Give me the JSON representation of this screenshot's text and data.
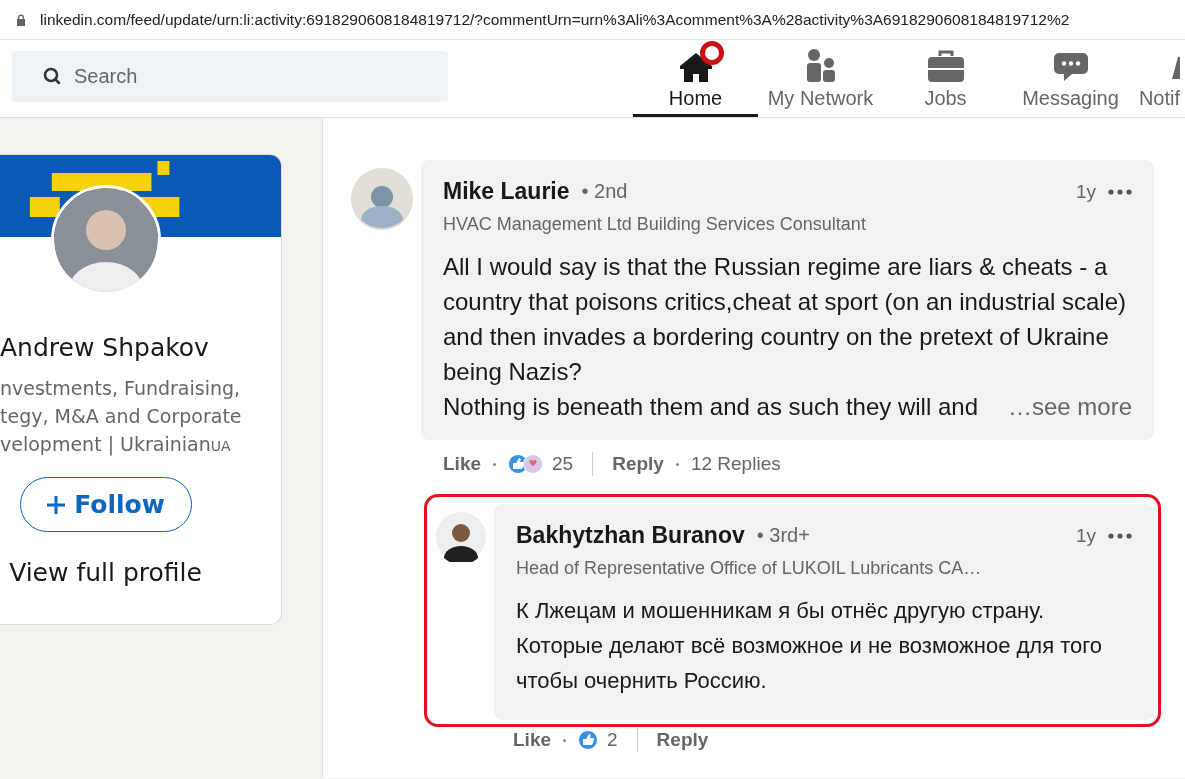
{
  "address_bar": {
    "url": "linkedin.com/feed/update/urn:li:activity:6918290608184819712/?commentUrn=urn%3Ali%3Acomment%3A%28activity%3A6918290608184819712%2"
  },
  "nav": {
    "search": {
      "placeholder": "Search"
    },
    "items": [
      {
        "label": "Home",
        "selected": true,
        "notification_dot": true
      },
      {
        "label": "My Network",
        "selected": false,
        "notification_dot": false
      },
      {
        "label": "Jobs",
        "selected": false,
        "notification_dot": false
      },
      {
        "label": "Messaging",
        "selected": false,
        "notification_dot": false
      },
      {
        "label": "Notif",
        "selected": false,
        "notification_dot": false
      }
    ]
  },
  "profile_card": {
    "name": "Andrew Shpakov",
    "headline_lines": [
      "nvestments, Fundraising,",
      "tegy, M&A and Corporate",
      "velopment | Ukrainian"
    ],
    "headline_tag": "UA",
    "follow_button": "Follow",
    "view_profile": "View full profile"
  },
  "comments": [
    {
      "author": "Mike Laurie",
      "degree": "• 2nd",
      "headline": "HVAC Management Ltd Building Services Consultant",
      "time": "1y",
      "body": [
        "All I would say is that the Russian regime are liars & cheats - a country that poisons critics,cheat at sport (on an industrial scale) and then invades a bordering country on the pretext of Ukraine being Nazis?",
        "Nothing is beneath them and as such they will and"
      ],
      "see_more": "…see more",
      "actions": {
        "like": "Like",
        "reaction_count": "25",
        "reply": "Reply",
        "replies": "12 Replies"
      },
      "replies": [
        {
          "author": "Bakhytzhan Buranov",
          "degree": "• 3rd+",
          "headline": "Head of Representative Office of LUKOIL Lubricants CA…",
          "time": "1y",
          "highlighted": true,
          "body": [
            "К Лжецам и мошенникам я бы отнёс другую страну. Которые делают всё возможное и не возможное для того чтобы очернить Россию."
          ],
          "actions": {
            "like": "Like",
            "reaction_count": "2",
            "reply": "Reply"
          }
        }
      ]
    }
  ]
}
